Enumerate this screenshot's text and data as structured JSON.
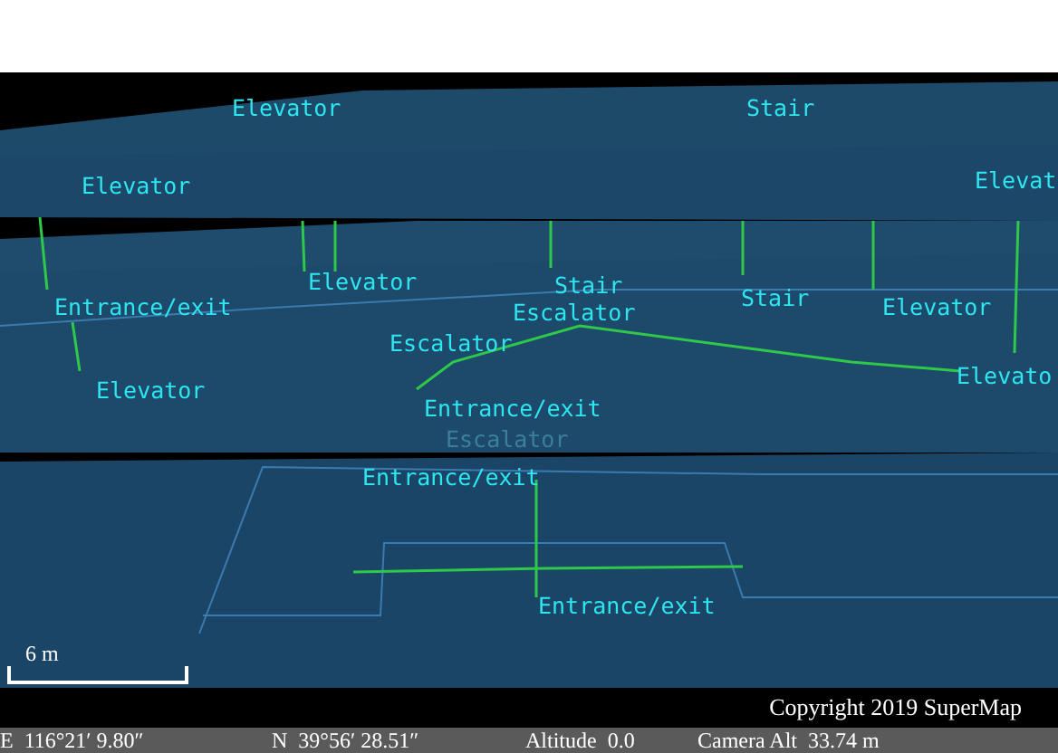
{
  "map_labels": [
    {
      "text": "Elevator",
      "kind": "elevator"
    },
    {
      "text": "Stair",
      "kind": "stair"
    },
    {
      "text": "Elevator",
      "kind": "elevator"
    },
    {
      "text": "Elevat",
      "kind": "elevator"
    },
    {
      "text": "Elevator",
      "kind": "elevator"
    },
    {
      "text": "Stair",
      "kind": "stair"
    },
    {
      "text": "Entrance/exit",
      "kind": "entrance"
    },
    {
      "text": "Escalator",
      "kind": "escalator"
    },
    {
      "text": "Stair",
      "kind": "stair"
    },
    {
      "text": "Elevator",
      "kind": "elevator"
    },
    {
      "text": "Escalator",
      "kind": "escalator"
    },
    {
      "text": "Elevato",
      "kind": "elevator"
    },
    {
      "text": "Elevator",
      "kind": "elevator"
    },
    {
      "text": "Entrance/exit",
      "kind": "entrance"
    },
    {
      "text": "Escalator",
      "kind": "faded"
    },
    {
      "text": "Entrance/exit",
      "kind": "entrance"
    },
    {
      "text": "Entrance/exit",
      "kind": "entrance"
    }
  ],
  "scale_bar": {
    "label": "6 m"
  },
  "copyright": "Copyright 2019 SuperMap",
  "status_bar": {
    "longitude": "E  116°21′ 9.80″",
    "latitude": "N  39°56′ 28.51″",
    "altitude": "Altitude  0.0",
    "camera_alt": "Camera Alt  33.74 m"
  }
}
